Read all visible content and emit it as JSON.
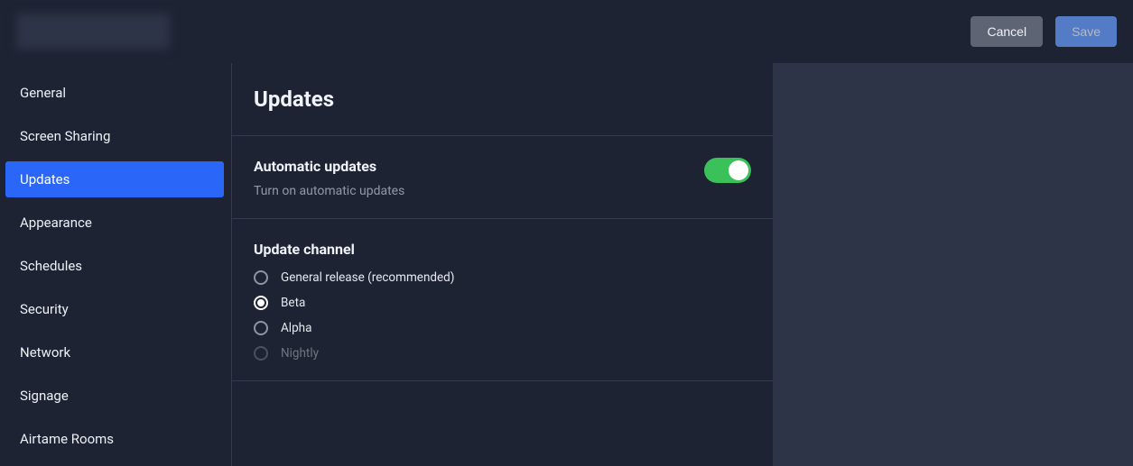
{
  "header": {
    "cancel_label": "Cancel",
    "save_label": "Save"
  },
  "sidebar": {
    "items": [
      {
        "label": "General",
        "active": false
      },
      {
        "label": "Screen Sharing",
        "active": false
      },
      {
        "label": "Updates",
        "active": true
      },
      {
        "label": "Appearance",
        "active": false
      },
      {
        "label": "Schedules",
        "active": false
      },
      {
        "label": "Security",
        "active": false
      },
      {
        "label": "Network",
        "active": false
      },
      {
        "label": "Signage",
        "active": false
      },
      {
        "label": "Airtame Rooms",
        "active": false
      }
    ]
  },
  "main": {
    "title": "Updates",
    "auto_updates": {
      "title": "Automatic updates",
      "description": "Turn on automatic updates",
      "enabled": true
    },
    "channel": {
      "title": "Update channel",
      "options": [
        {
          "label": "General release (recommended)",
          "selected": false,
          "disabled": false
        },
        {
          "label": "Beta",
          "selected": true,
          "disabled": false
        },
        {
          "label": "Alpha",
          "selected": false,
          "disabled": false
        },
        {
          "label": "Nightly",
          "selected": false,
          "disabled": true
        }
      ]
    }
  },
  "colors": {
    "accent": "#2a66f7",
    "toggle_on": "#3ac15a",
    "bg_dark": "#1d2333",
    "bg_outer": "#2d3447"
  }
}
